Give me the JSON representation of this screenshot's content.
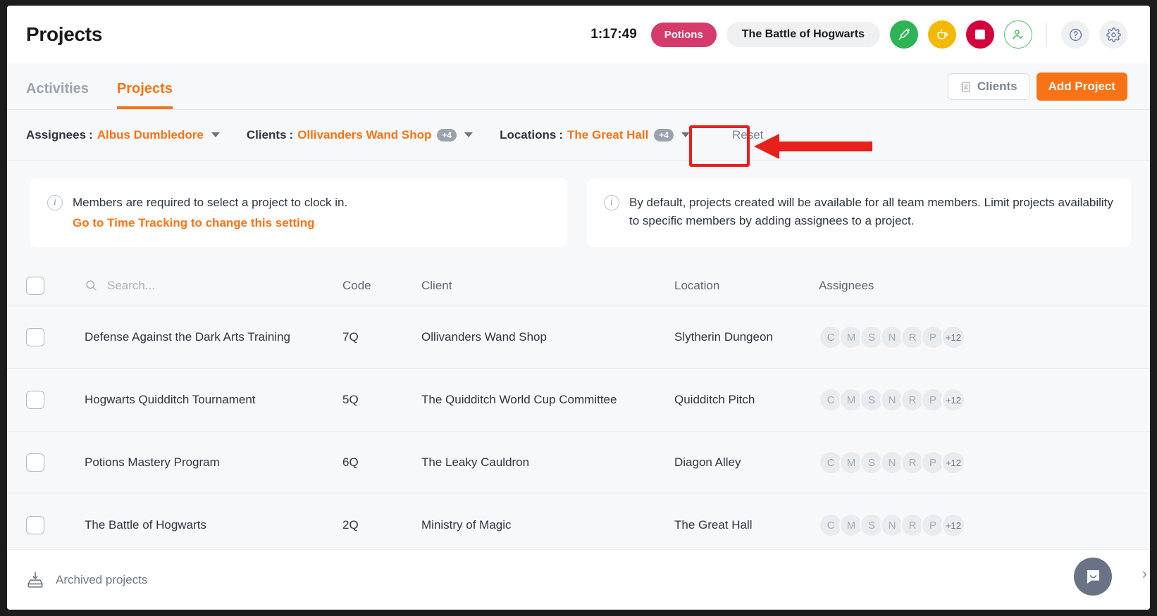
{
  "header": {
    "title": "Projects",
    "timer": "1:17:49",
    "current_task": "Potions",
    "current_project": "The Battle of Hogwarts",
    "actions": [
      {
        "name": "break-pencil-button",
        "icon": "pencil-break-icon",
        "color": "#2eb355"
      },
      {
        "name": "coffee-break-button",
        "icon": "coffee-cup-icon",
        "color": "#f5b800"
      },
      {
        "name": "stop-timer-button",
        "icon": "stop-square-icon",
        "color": "#d4003c"
      },
      {
        "name": "clock-out-button",
        "icon": "user-check-icon",
        "color": "#4fc26b"
      },
      {
        "name": "help-button",
        "icon": "question-mark-icon",
        "color": "#eef0f2"
      },
      {
        "name": "settings-button",
        "icon": "gear-icon",
        "color": "#eef0f2"
      }
    ]
  },
  "tabs": [
    {
      "label": "Activities",
      "active": false
    },
    {
      "label": "Projects",
      "active": true
    }
  ],
  "toolbar": {
    "clients_label": "Clients",
    "add_project_label": "Add Project"
  },
  "filters": [
    {
      "label": "Assignees",
      "separator": ":",
      "value": "Albus Dumbledore",
      "count": ""
    },
    {
      "label": "Clients",
      "separator": ":",
      "value": "Ollivanders Wand Shop",
      "count": "+4"
    },
    {
      "label": "Locations",
      "separator": ":",
      "value": "The Great Hall",
      "count": "+4"
    }
  ],
  "reset_label": "Reset",
  "banners": [
    {
      "text": "Members are required to select a project to clock in.",
      "link": "Go to Time Tracking to change this setting"
    },
    {
      "text": "By default, projects created will be available for all team members. Limit projects availability to specific members by adding assignees to a project.",
      "link": ""
    }
  ],
  "table": {
    "search_placeholder": "Search...",
    "columns": [
      "Code",
      "Client",
      "Location",
      "Assignees"
    ],
    "rows": [
      {
        "name": "Defense Against the Dark Arts Training",
        "code": "7Q",
        "client": "Ollivanders Wand Shop",
        "location": "Slytherin Dungeon",
        "assignees": [
          "C",
          "M",
          "S",
          "N",
          "R",
          "P"
        ],
        "assignees_more": "+12"
      },
      {
        "name": "Hogwarts Quidditch Tournament",
        "code": "5Q",
        "client": "The Quidditch World Cup Committee",
        "location": "Quidditch Pitch",
        "assignees": [
          "C",
          "M",
          "S",
          "N",
          "R",
          "P"
        ],
        "assignees_more": "+12"
      },
      {
        "name": "Potions Mastery Program",
        "code": "6Q",
        "client": "The Leaky Cauldron",
        "location": "Diagon Alley",
        "assignees": [
          "C",
          "M",
          "S",
          "N",
          "R",
          "P"
        ],
        "assignees_more": "+12"
      },
      {
        "name": "The Battle of Hogwarts",
        "code": "2Q",
        "client": "Ministry of Magic",
        "location": "The Great Hall",
        "assignees": [
          "C",
          "M",
          "S",
          "N",
          "R",
          "P"
        ],
        "assignees_more": "+12"
      }
    ]
  },
  "footer": {
    "archived_label": "Archived projects"
  },
  "colors": {
    "accent": "#f97316",
    "task_pill": "#d63a6a",
    "annotation": "#e8201c",
    "page_bg": "#f7f8fa"
  }
}
